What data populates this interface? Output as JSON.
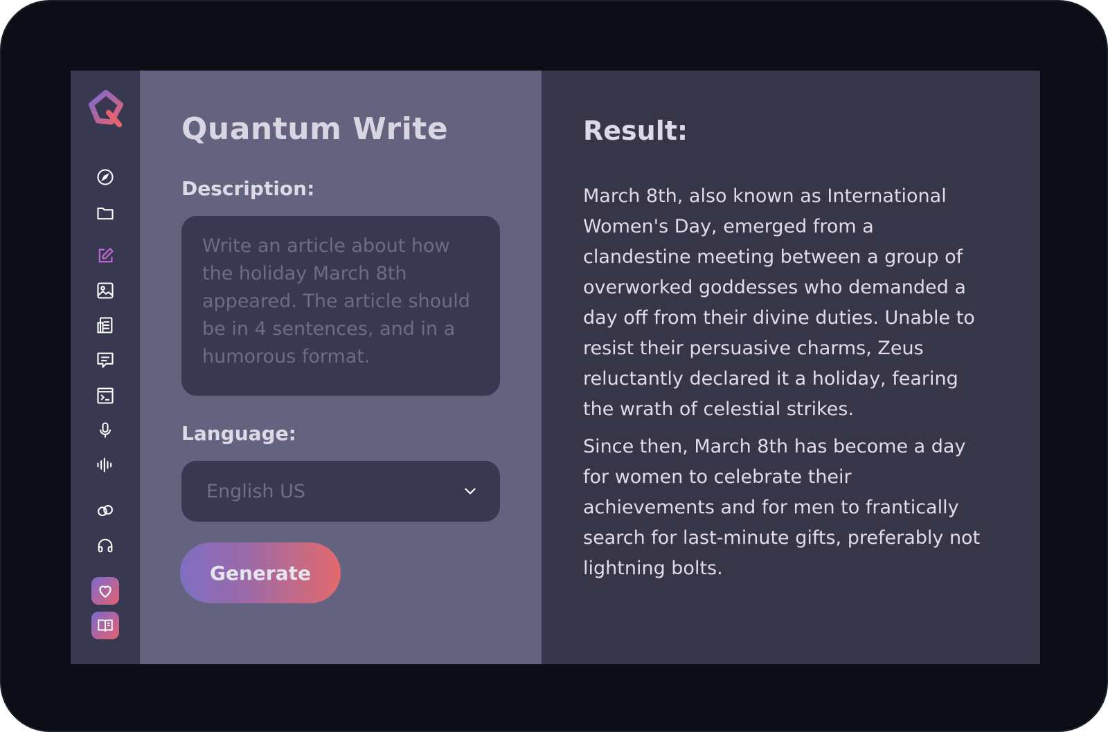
{
  "app": {
    "title": "Quantum Write"
  },
  "sidebar": {
    "logo_icon": "quantum-q-logo",
    "items": [
      {
        "icon": "compass-icon",
        "active": false
      },
      {
        "icon": "folder-icon",
        "active": false
      },
      {
        "icon": "edit-icon",
        "active": true
      },
      {
        "icon": "image-icon",
        "active": false
      },
      {
        "icon": "document-icon",
        "active": false
      },
      {
        "icon": "chat-icon",
        "active": false
      },
      {
        "icon": "terminal-icon",
        "active": false
      },
      {
        "icon": "microphone-icon",
        "active": false
      },
      {
        "icon": "audio-wave-icon",
        "active": false
      },
      {
        "icon": "link-icon",
        "active": false
      },
      {
        "icon": "headphones-icon",
        "active": false
      },
      {
        "icon": "heart-icon",
        "active": false
      },
      {
        "icon": "book-icon",
        "active": false
      }
    ]
  },
  "form": {
    "description_label": "Description:",
    "description_placeholder": "Write an article about how the holiday March 8th appeared. The article should be in 4 sentences, and in a humorous format.",
    "language_label": "Language:",
    "language_value": "English US",
    "generate_label": "Generate"
  },
  "result": {
    "title": "Result:",
    "paragraphs": [
      "March 8th, also known as International Women's Day, emerged from a clandestine meeting between a group of overworked goddesses who demanded a day off from their divine duties. Unable to resist their persuasive charms, Zeus reluctantly declared it a holiday, fearing the wrath of celestial strikes.",
      "Since then, March 8th has become a day for women to celebrate their achievements and for men to frantically search for last-minute gifts, preferably not lightning bolts."
    ]
  },
  "colors": {
    "sidebar_bg": "#383850",
    "form_panel_bg": "#64637f",
    "result_panel_bg": "#373649",
    "accent_gradient_start": "#7b6ad0",
    "accent_gradient_end": "#e5626e",
    "frame_bg": "#0b0e16"
  }
}
